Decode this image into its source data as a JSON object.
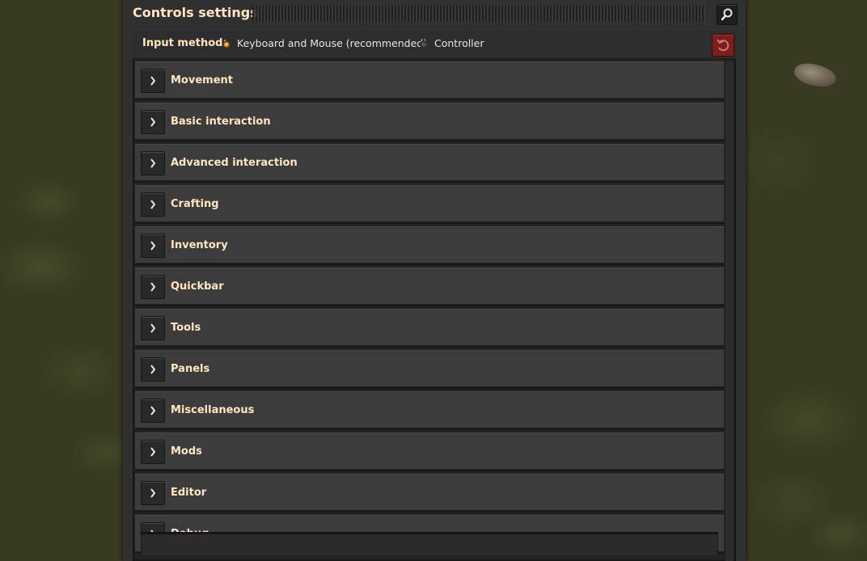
{
  "window": {
    "title": "Controls settings"
  },
  "input_method": {
    "label": "Input method:",
    "options": [
      {
        "label": "Keyboard and Mouse (recommended)",
        "selected": true
      },
      {
        "label": "Controller",
        "selected": false
      }
    ]
  },
  "categories": [
    {
      "label": "Movement"
    },
    {
      "label": "Basic interaction"
    },
    {
      "label": "Advanced interaction"
    },
    {
      "label": "Crafting"
    },
    {
      "label": "Inventory"
    },
    {
      "label": "Quickbar"
    },
    {
      "label": "Tools"
    },
    {
      "label": "Panels"
    },
    {
      "label": "Miscellaneous"
    },
    {
      "label": "Mods"
    },
    {
      "label": "Editor"
    },
    {
      "label": "Debug"
    }
  ],
  "colors": {
    "heading": "#ffe6c0",
    "selected_radio": "#ffb23a",
    "reset_button": "#7a1e1e"
  },
  "icons": {
    "search": "search-icon",
    "reset": "reset-icon",
    "expand": "chevron-right-icon"
  }
}
